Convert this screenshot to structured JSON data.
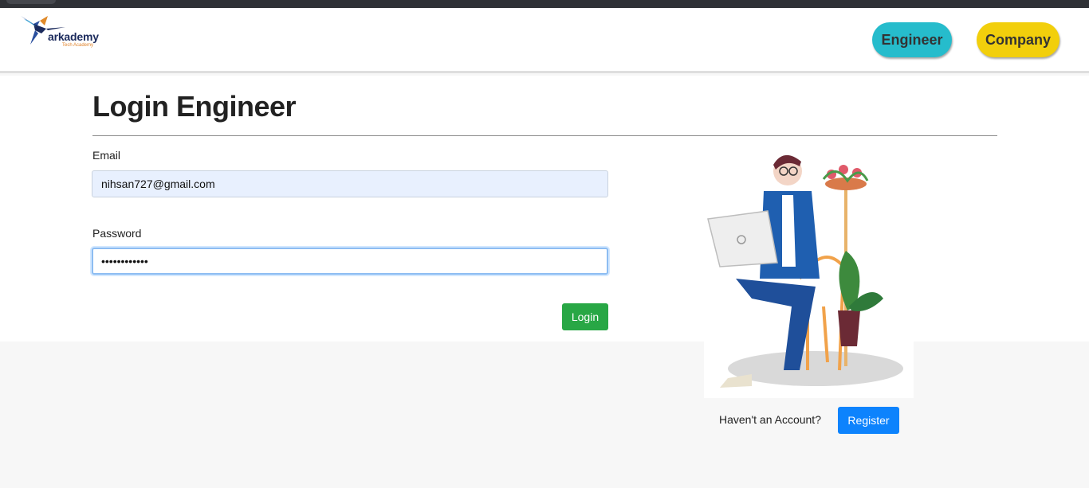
{
  "brand": {
    "name": "arkademy",
    "tagline": "Tech Academy"
  },
  "nav": {
    "engineer_label": "Engineer",
    "company_label": "Company"
  },
  "page": {
    "title": "Login Engineer"
  },
  "form": {
    "email_label": "Email",
    "email_value": "nihsan727@gmail.com",
    "password_label": "Password",
    "password_value": "••••••••••••",
    "login_label": "Login"
  },
  "register": {
    "prompt": "Haven't an Account?",
    "button_label": "Register"
  },
  "colors": {
    "engineer": "#26bccc",
    "company": "#f2cf0c",
    "login": "#28a745",
    "register": "#0d83fd"
  }
}
